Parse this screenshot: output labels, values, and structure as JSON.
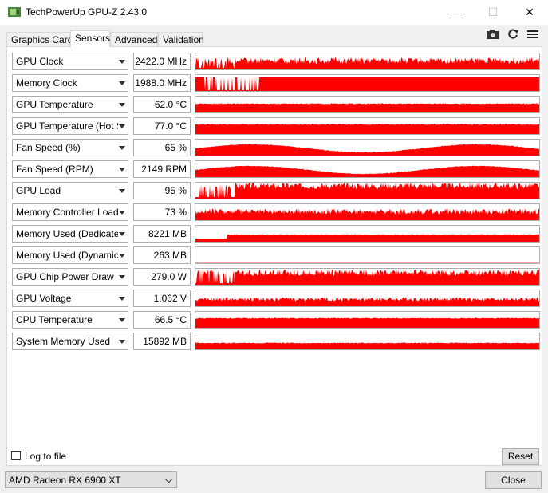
{
  "window": {
    "title": "TechPowerUp GPU-Z 2.43.0",
    "minimize": "—",
    "maximize": "☐",
    "close": "✕"
  },
  "tabs": [
    {
      "label": "Graphics Card"
    },
    {
      "label": "Sensors"
    },
    {
      "label": "Advanced"
    },
    {
      "label": "Validation"
    }
  ],
  "colors": {
    "graph": "#ff0000",
    "accent": "#ff0000"
  },
  "icons": {
    "camera": "camera-icon",
    "refresh": "refresh-icon",
    "menu": "menu-icon"
  },
  "sensors": [
    {
      "name": "GPU Clock",
      "value": "2422.0 MHz",
      "level": 0.55,
      "profile": "spiky"
    },
    {
      "name": "Memory Clock",
      "value": "1988.0 MHz",
      "level": 0.55,
      "profile": "gapped"
    },
    {
      "name": "GPU Temperature",
      "value": "62.0 °C",
      "level": 0.55,
      "profile": "flat"
    },
    {
      "name": "GPU Temperature (Hot Spot)",
      "value": "77.0 °C",
      "level": 0.6,
      "profile": "flat"
    },
    {
      "name": "Fan Speed (%)",
      "value": "65 %",
      "level": 0.45,
      "profile": "wave"
    },
    {
      "name": "Fan Speed (RPM)",
      "value": "2149 RPM",
      "level": 0.45,
      "profile": "wave"
    },
    {
      "name": "GPU Load",
      "value": "95 %",
      "level": 0.8,
      "profile": "spiky"
    },
    {
      "name": "Memory Controller Load",
      "value": "73 %",
      "level": 0.55,
      "profile": "noisy"
    },
    {
      "name": "Memory Used (Dedicated)",
      "value": "8221 MB",
      "level": 0.45,
      "profile": "step"
    },
    {
      "name": "Memory Used (Dynamic)",
      "value": "263 MB",
      "level": 0.02,
      "profile": "empty"
    },
    {
      "name": "GPU Chip Power Draw",
      "value": "279.0 W",
      "level": 0.75,
      "profile": "spiky"
    },
    {
      "name": "GPU Voltage",
      "value": "1.062 V",
      "level": 0.45,
      "profile": "dense"
    },
    {
      "name": "CPU Temperature",
      "value": "66.5 °C",
      "level": 0.6,
      "profile": "flat"
    },
    {
      "name": "System Memory Used",
      "value": "15892 MB",
      "level": 0.4,
      "profile": "flat"
    }
  ],
  "footer": {
    "log_to_file": "Log to file",
    "reset": "Reset",
    "gpu_select": "AMD Radeon RX 6900 XT",
    "close": "Close"
  }
}
